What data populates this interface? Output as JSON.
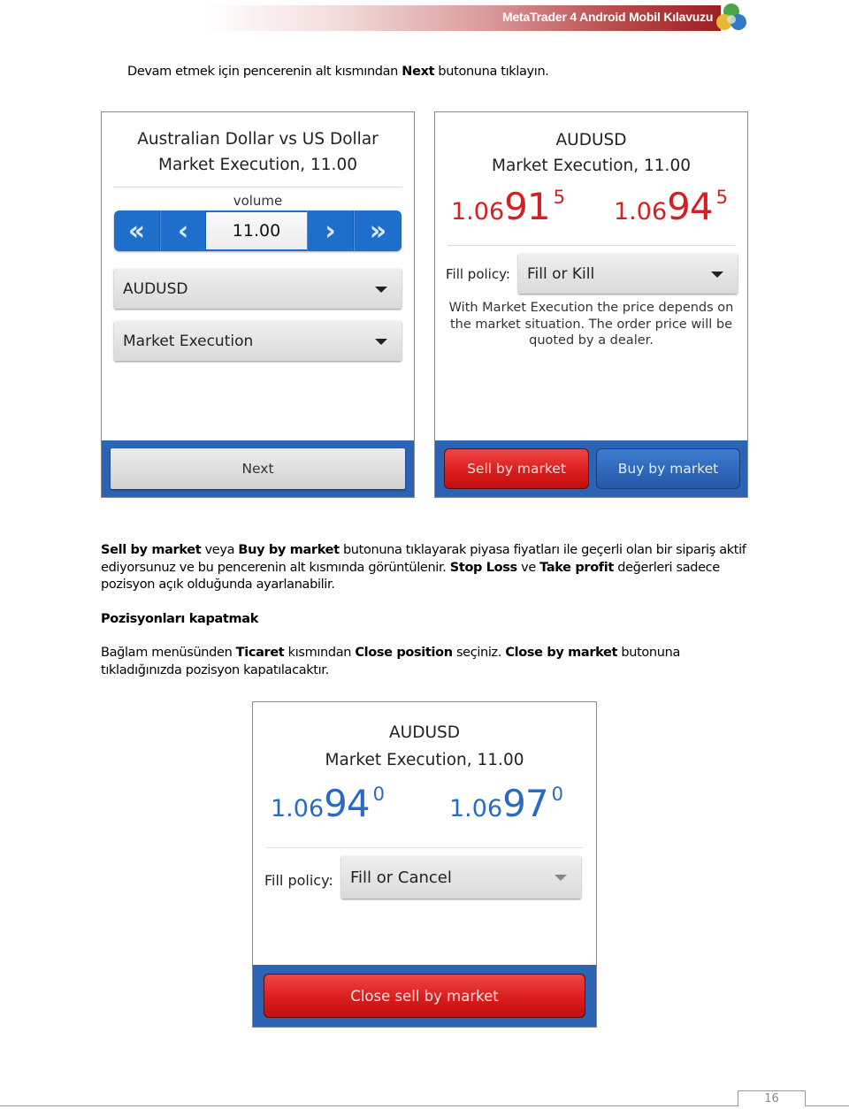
{
  "header": {
    "title": "MetaTrader 4 Android Mobil Kılavuzu",
    "logo_icon": "metatrader-logo-icon"
  },
  "intro": {
    "before": "Devam etmek için pencerenin alt kısmından ",
    "bold": "Next",
    "after": " butonuna tıklayın."
  },
  "screen1": {
    "title_line1": "Australian Dollar vs US Dollar",
    "title_line2": "Market Execution, 11.00",
    "volume_label": "volume",
    "volume_value": "11.00",
    "buttons": {
      "fast_decrease": "«",
      "decrease": "‹",
      "increase": "›",
      "fast_increase": "»"
    },
    "symbol_select": "AUDUSD",
    "type_select": "Market Execution",
    "next_label": "Next"
  },
  "screen2": {
    "title_line1": "AUDUSD",
    "title_line2": "Market Execution, 11.00",
    "bid": {
      "prefix": "1.06",
      "big": "91",
      "sup": "5"
    },
    "ask": {
      "prefix": "1.06",
      "big": "94",
      "sup": "5"
    },
    "price_color": "#d42020",
    "fill_label": "Fill policy:",
    "fill_value": "Fill or Kill",
    "note": "With Market Execution the price depends on the market situation. The order price will be quoted by a dealer.",
    "sell_label": "Sell by market",
    "buy_label": "Buy by market"
  },
  "body": {
    "p1": {
      "b1": "Sell  by market",
      "t1": " veya ",
      "b2": "Buy by market",
      "t2": " butonuna tıklayarak piyasa fiyatları ile geçerli olan bir sipariş aktif ediyorsunuz ve bu pencerenin alt kısmında görüntülenir. ",
      "b3": "Stop Loss",
      "t3": " ve ",
      "b4": "Take profit",
      "t4": " değerleri sadece pozisyon açık olduğunda ayarlanabilir."
    },
    "heading": "Pozisyonları kapatmak",
    "p2": {
      "t1": "Bağlam menüsünden ",
      "b1": "Ticaret",
      "t2": " kısmından ",
      "b2": "Close position",
      "t3": " seçiniz. ",
      "b3": "Close by market",
      "t4": " butonuna tıkladığınızda pozisyon kapatılacaktır."
    }
  },
  "screen3": {
    "title_line1": "AUDUSD",
    "title_line2": "Market Execution, 11.00",
    "bid": {
      "prefix": "1.06",
      "big": "94",
      "sup": "0"
    },
    "ask": {
      "prefix": "1.06",
      "big": "97",
      "sup": "0"
    },
    "price_color": "#2a6ac4",
    "fill_label": "Fill policy:",
    "fill_value": "Fill or Cancel",
    "close_label": "Close sell by market"
  },
  "footer": {
    "page_number": "16"
  }
}
